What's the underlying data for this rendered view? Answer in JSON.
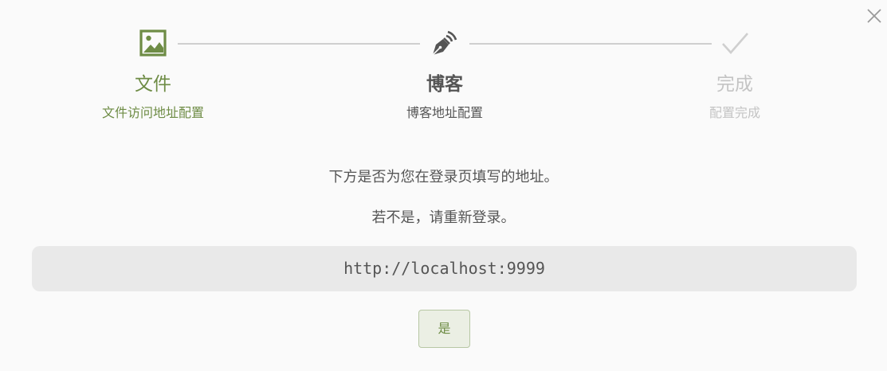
{
  "steps": [
    {
      "title": "文件",
      "subtitle": "文件访问地址配置",
      "icon": "image-icon",
      "state": "done",
      "color": "#6e8c45"
    },
    {
      "title": "博客",
      "subtitle": "博客地址配置",
      "icon": "fountain-pen-icon",
      "state": "current",
      "color": "#555555"
    },
    {
      "title": "完成",
      "subtitle": "配置完成",
      "icon": "checkmark-icon",
      "state": "todo",
      "color": "#c4c4c4"
    }
  ],
  "message": {
    "line1": "下方是否为您在登录页填写的地址。",
    "line2": "若不是，请重新登录。"
  },
  "url": "http://localhost:9999",
  "confirm_label": "是",
  "close_icon": "close-icon"
}
